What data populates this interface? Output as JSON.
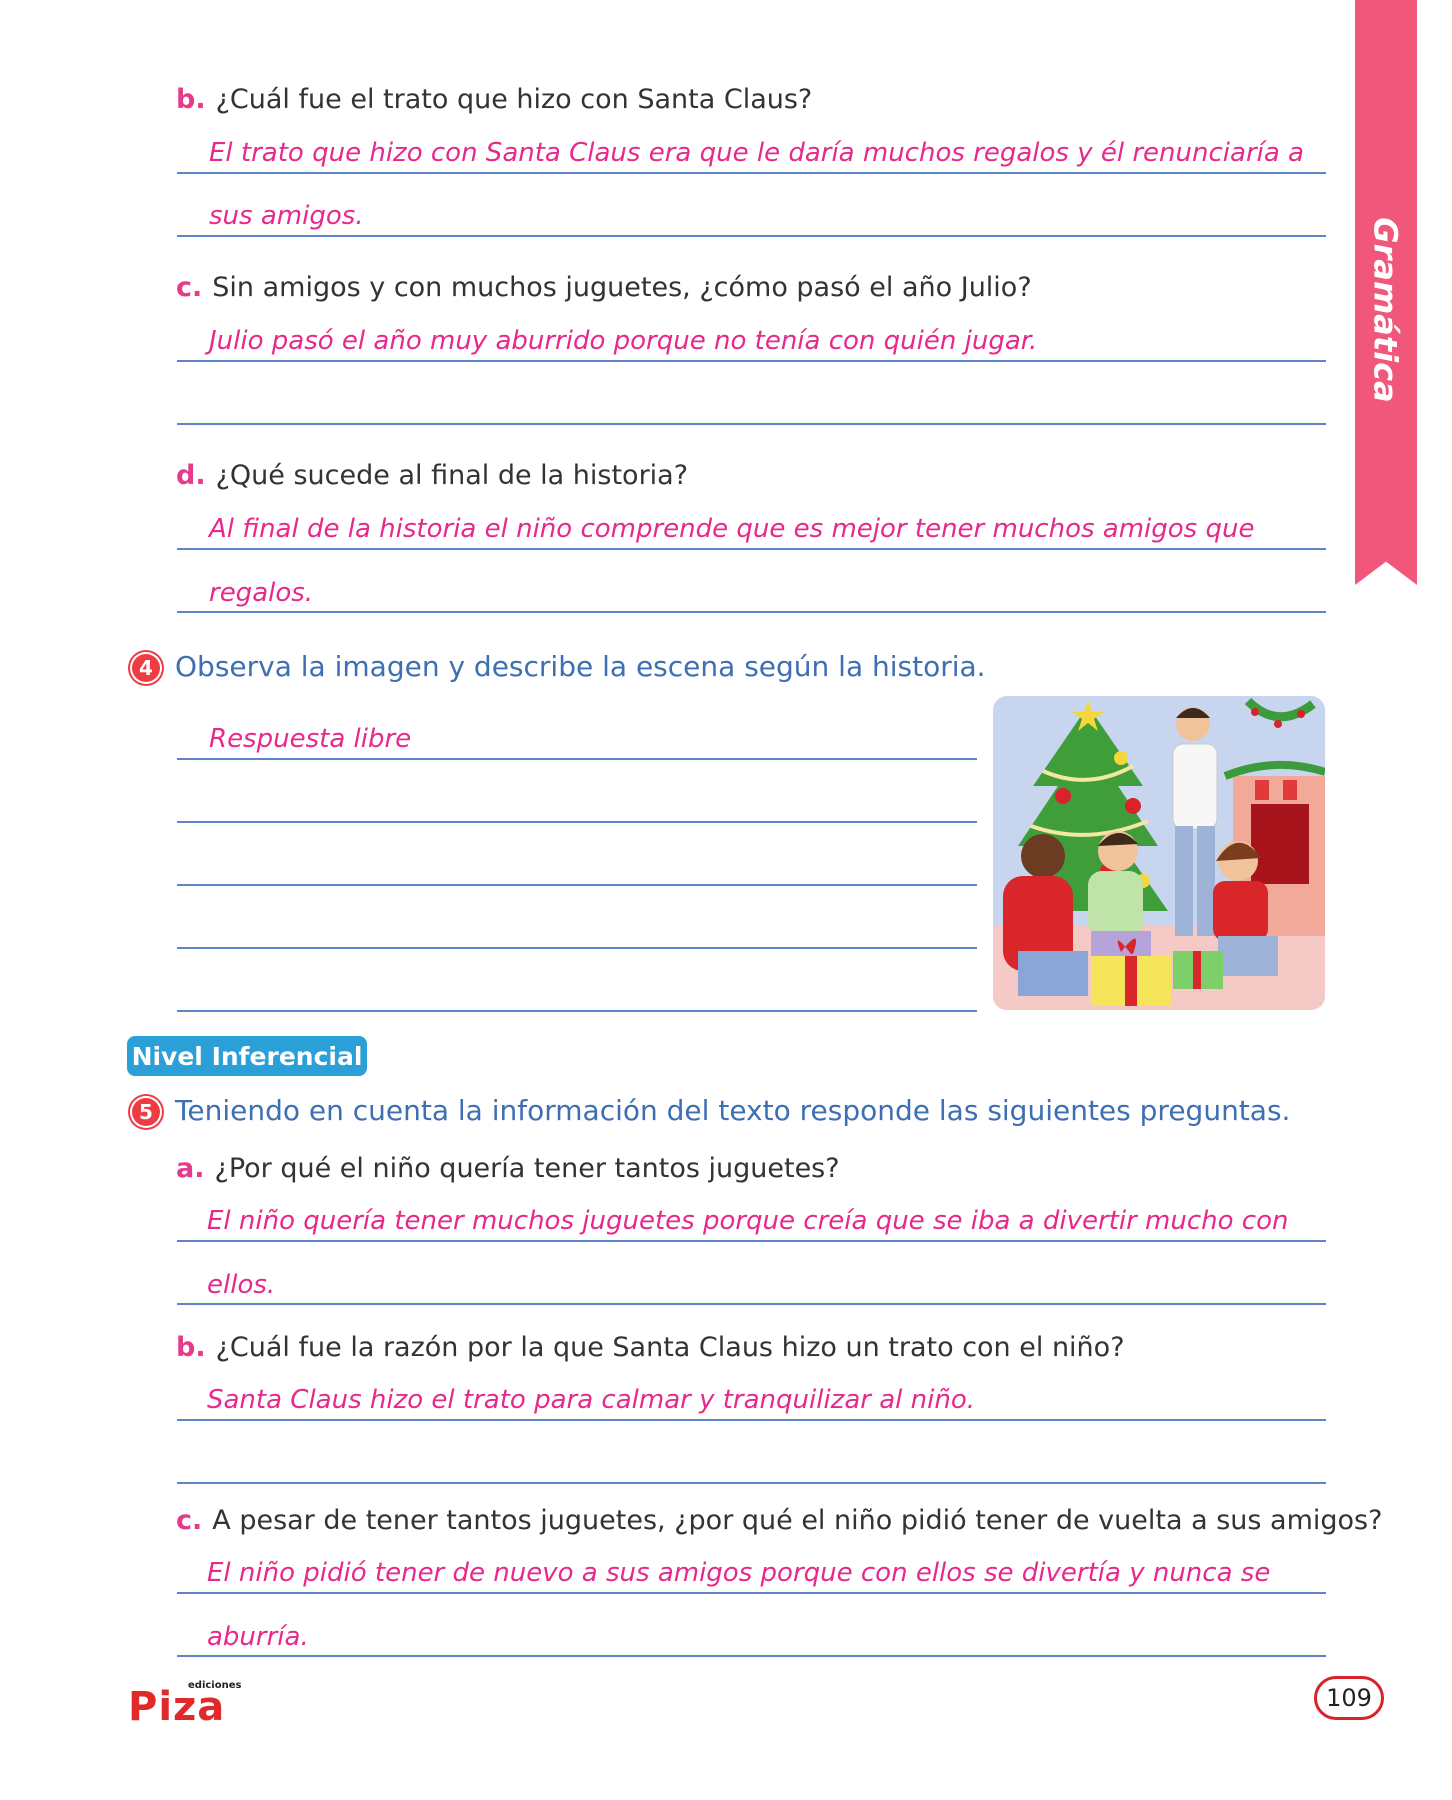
{
  "side_tab": {
    "label": "Gramática"
  },
  "section3": {
    "questions": [
      {
        "letter": "b.",
        "text": "¿Cuál fue el trato que hizo con Santa Claus?",
        "answer_lines": [
          "El trato que hizo con Santa Claus era que le daría muchos regalos y él renunciaría a",
          "sus amigos."
        ]
      },
      {
        "letter": "c.",
        "text": "Sin amigos y con muchos juguetes, ¿cómo pasó el año Julio?",
        "answer_lines": [
          "Julio pasó el año muy aburrido porque no tenía con quién jugar.",
          ""
        ]
      },
      {
        "letter": "d.",
        "text": "¿Qué sucede al final de la historia?",
        "answer_lines": [
          "Al final de la historia el niño comprende que es mejor tener muchos amigos que",
          "regalos."
        ]
      }
    ]
  },
  "exercise4": {
    "number": "4",
    "instruction": "Observa la imagen y describe la escena según la historia.",
    "answer": "Respuesta libre"
  },
  "level_badge": "Nivel Inferencial",
  "exercise5": {
    "number": "5",
    "instruction": "Teniendo en cuenta la información del texto responde las siguientes preguntas.",
    "questions": [
      {
        "letter": "a.",
        "text": "¿Por qué el niño quería tener tantos juguetes?",
        "answer_lines": [
          "El niño quería tener muchos juguetes porque creía que se iba a divertir mucho con",
          "ellos."
        ]
      },
      {
        "letter": "b.",
        "text": "¿Cuál fue la razón por la que Santa Claus hizo un trato con el niño?",
        "answer_lines": [
          "Santa Claus hizo el trato para calmar y tranquilizar al niño.",
          ""
        ]
      },
      {
        "letter": "c.",
        "text": "A pesar de tener tantos juguetes, ¿por qué el niño pidió tener de vuelta a sus amigos?",
        "answer_lines": [
          "El niño pidió tener de nuevo a sus amigos porque con ellos se divertía y nunca se",
          "aburría."
        ]
      }
    ]
  },
  "footer": {
    "logo_small": "ediciones",
    "logo_main": "Piza",
    "page_number": "109"
  }
}
